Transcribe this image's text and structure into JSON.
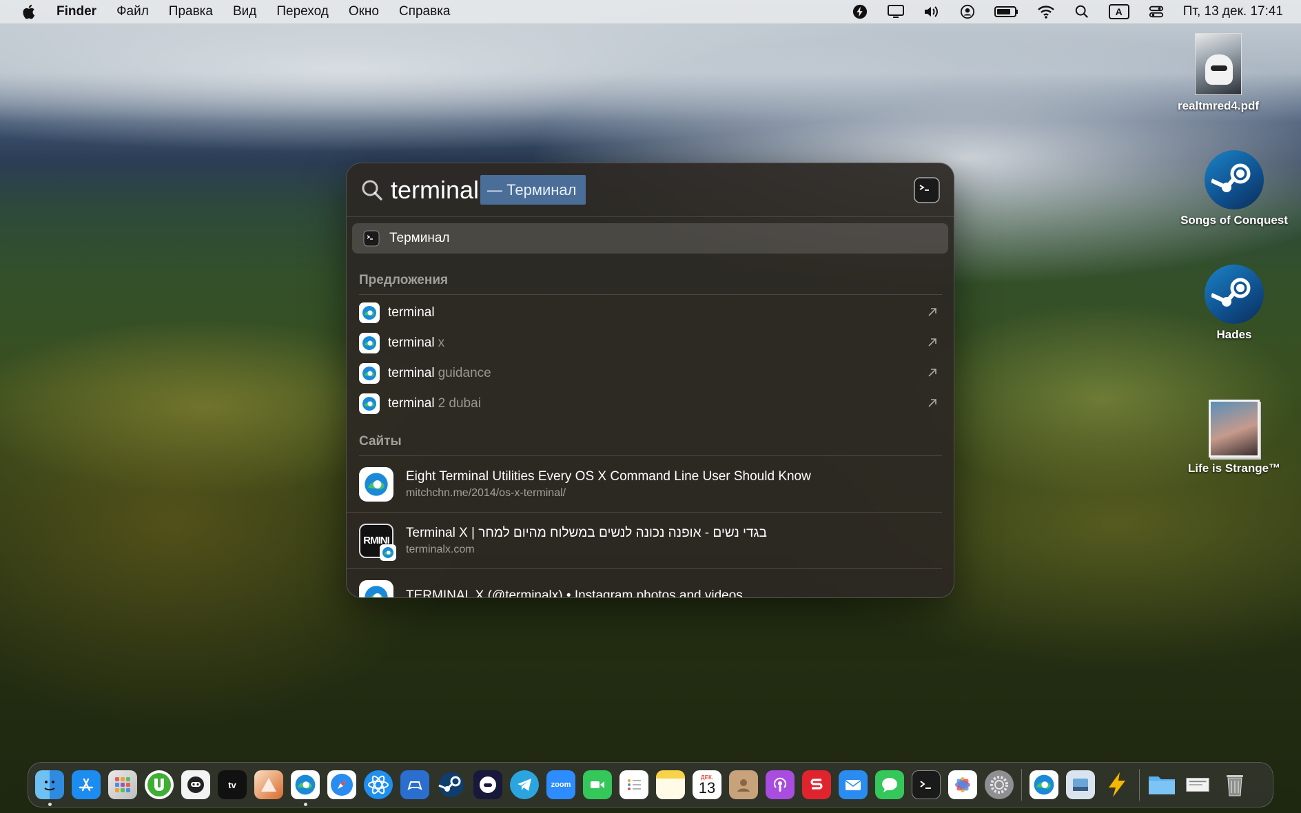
{
  "menubar": {
    "app_name": "Finder",
    "menus": [
      "Файл",
      "Правка",
      "Вид",
      "Переход",
      "Окно",
      "Справка"
    ],
    "input_source": "A",
    "clock": "Пт, 13 дек.  17:41"
  },
  "desktop": {
    "items": [
      {
        "label": "realtmred4.pdf",
        "icon": "pdf-document-icon"
      },
      {
        "label": "Songs of Conquest",
        "icon": "steam-icon"
      },
      {
        "label": "Hades",
        "icon": "steam-icon"
      },
      {
        "label": "Life is Strange™",
        "icon": "game-icon"
      }
    ]
  },
  "spotlight": {
    "query": "terminal",
    "completion": "— Терминал",
    "top_hit": "Терминал",
    "suggestions_title": "Предложения",
    "suggestions": [
      {
        "bold": "terminal",
        "rest": ""
      },
      {
        "bold": "terminal",
        "rest": "x"
      },
      {
        "bold": "terminal",
        "rest": "guidance"
      },
      {
        "bold": "terminal",
        "rest": "2 dubai"
      }
    ],
    "sites_title": "Сайты",
    "sites": [
      {
        "title": "Eight Terminal Utilities Every OS X Command Line User Should Know",
        "url": "mitchchn.me/2014/os-x-terminal/"
      },
      {
        "title": "Terminal X | בגדי נשים - אופנה נכונה לנשים במשלוח מהיום למחר",
        "url": "terminalx.com",
        "icon_text": "RMINI"
      },
      {
        "title": "TERMINAL X (@terminalx) • Instagram photos and videos",
        "url": ""
      }
    ]
  },
  "dock": {
    "zoom_label": "zoom",
    "tv_label": "tv",
    "calendar_month": "ДЕК.",
    "calendar_day": "13"
  },
  "colors": {
    "accent": "#4a6e97",
    "edge_blue": "#1a8ad8",
    "edge_green": "#41c36a"
  }
}
